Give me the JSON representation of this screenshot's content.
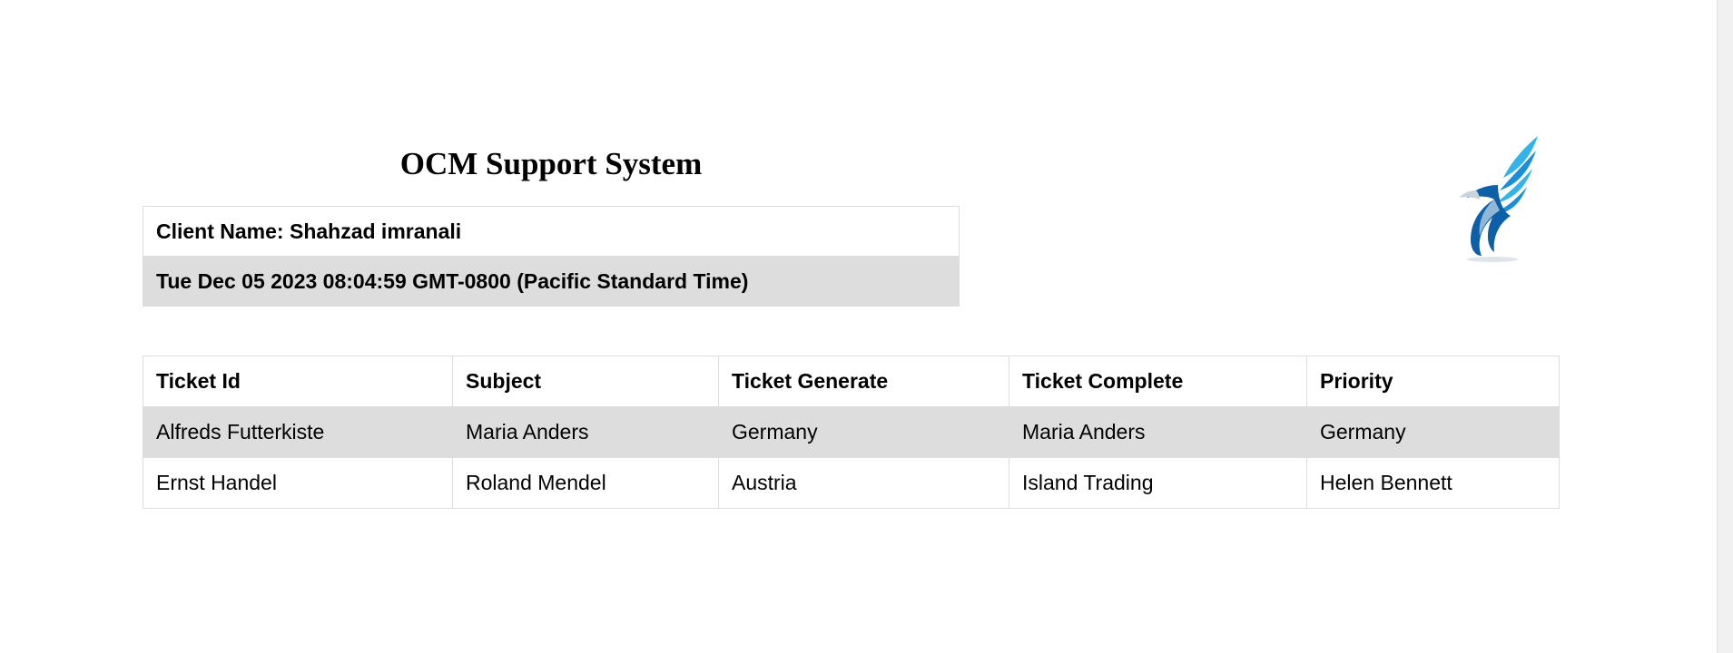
{
  "header": {
    "title": "OCM Support System",
    "client_name": "Client Name: Shahzad imranali",
    "datetime": "Tue Dec 05 2023 08:04:59 GMT-0800 (Pacific Standard Time)"
  },
  "logo": {
    "icon": "eagle-wing-logo",
    "colors": [
      "#1a8fd8",
      "#34b3e8",
      "#0d5fa8",
      "#c8d3dc"
    ]
  },
  "table": {
    "columns": [
      "Ticket Id",
      "Subject",
      "Ticket Generate",
      "Ticket Complete",
      "Priority"
    ],
    "rows": [
      [
        "Alfreds Futterkiste",
        "Maria Anders",
        "Germany",
        "Maria Anders",
        "Germany"
      ],
      [
        "Ernst Handel",
        "Roland Mendel",
        "Austria",
        "Island Trading",
        "Helen Bennett"
      ]
    ]
  },
  "colors": {
    "stripe": "#dddddd",
    "border": "#dddddd"
  }
}
